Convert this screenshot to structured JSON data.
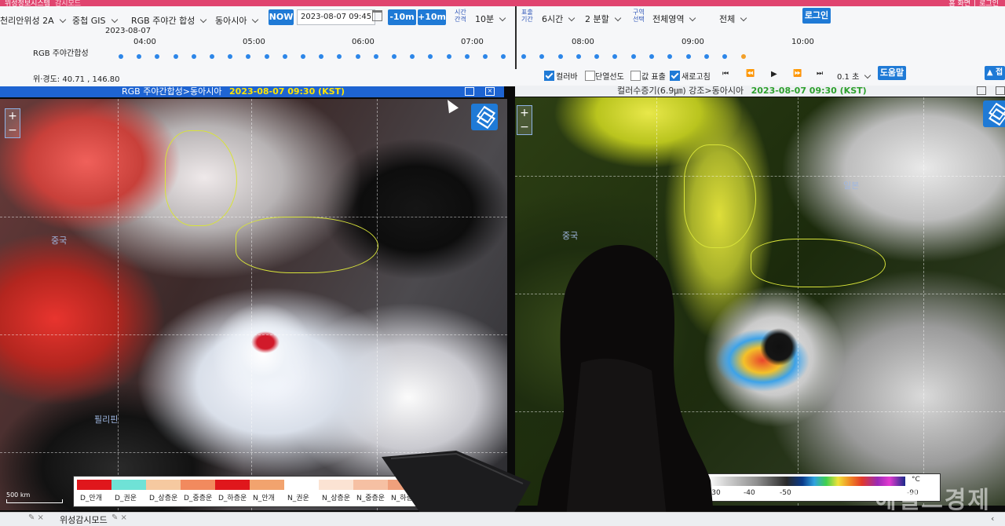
{
  "header": {
    "breadcrumb": "위성정보시스템",
    "mode": "감시모드",
    "right_links": "홈  화면 │ 로그인"
  },
  "toolbar": {
    "satellite": "천리안위성 2A",
    "gis": "중첩 GIS",
    "product": "RGB 주야간 합성",
    "region": "동아시아",
    "now_label": "NOW",
    "datetime": "2023-08-07 09:45",
    "minus_label": "-10m",
    "plus_label": "+10m",
    "interval_caption": "시간 간격",
    "interval_value": "10분",
    "period_caption": "표출 기간",
    "period_value": "6시간",
    "split_value": "2 분할",
    "area_caption": "구역 선택",
    "area_value": "전체영역",
    "all_value": "전체",
    "login_label": "로그인"
  },
  "timeline": {
    "date": "2023-08-07",
    "row_label": "RGB 주야간합성",
    "hours": [
      "04:00",
      "05:00",
      "06:00",
      "07:00",
      "08:00",
      "09:00",
      "10:00"
    ]
  },
  "info_bar": {
    "latlon": "위·경도: 40.71 , 146.80",
    "colorbar": "컬러바",
    "isotherm": "단열선도",
    "values": "값 표출",
    "refresh": "새로고침",
    "speed": "0.1 초",
    "help_label": "도움말",
    "top_label": "▲ 접"
  },
  "panel_left": {
    "title": "RGB 주야간합성>동아시아",
    "timestamp": "2023-08-07 09:30 (KST)",
    "map_label_china": "중국",
    "map_label_philippines": "필리핀",
    "scale": "500 km",
    "legend": [
      {
        "label": "D_안개",
        "color": "#e0171c"
      },
      {
        "label": "D_권운",
        "color": "#6fe2d6"
      },
      {
        "label": "D_상층운",
        "color": "#f6c9a0"
      },
      {
        "label": "D_중층운",
        "color": "#f28a5e"
      },
      {
        "label": "D_하층운",
        "color": "#e0171c"
      },
      {
        "label": "N_안개",
        "color": "#f2a36e"
      },
      {
        "label": "N_권운",
        "color": "#ffffff"
      },
      {
        "label": "N_상층운",
        "color": "#fbe3d3"
      },
      {
        "label": "N_중층운",
        "color": "#f6c0a3"
      },
      {
        "label": "N_하층운",
        "color": "#f0a07c"
      }
    ]
  },
  "panel_right": {
    "title": "컬러수증기(6.9㎛) 강조>동아시아",
    "timestamp": "2023-08-07 09:30 (KST)",
    "map_label_china": "중국",
    "map_label_japan": "일본",
    "unit": "°C",
    "ticks": [
      "-30",
      "-40",
      "-50",
      "-90"
    ]
  },
  "footer": {
    "tab1": "위성감시모드"
  },
  "watermark": "헤럴드경제"
}
